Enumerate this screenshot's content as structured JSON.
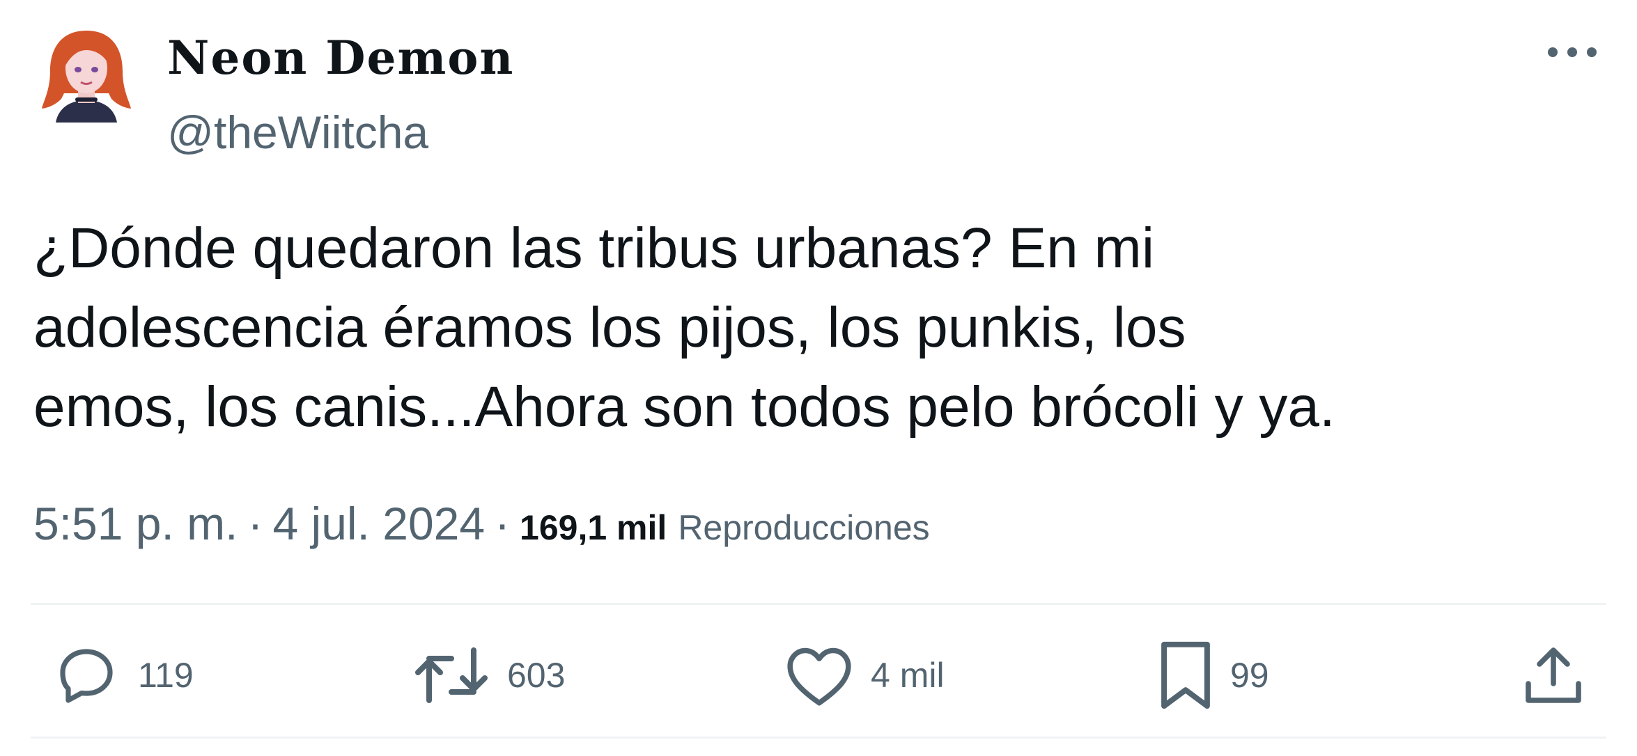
{
  "author": {
    "display_name": "Neon Demon",
    "handle": "@theWiitcha"
  },
  "tweet": {
    "text_lines": [
      "¿Dónde quedaron las tribus urbanas? En mi",
      "adolescencia éramos los pijos, los punkis, los",
      "emos, los canis...Ahora son todos pelo brócoli y ya."
    ]
  },
  "meta": {
    "time": "5:51 p. m.",
    "separator": "·",
    "date": "4 jul. 2024",
    "views_count": "169,1 mil",
    "views_label": "Reproducciones"
  },
  "actions": {
    "replies": "119",
    "retweets": "603",
    "likes": "4 mil",
    "bookmarks": "99"
  },
  "icons": {
    "more": "more-horizontal-icon",
    "reply": "reply-icon",
    "retweet": "retweet-icon",
    "like": "heart-icon",
    "bookmark": "bookmark-icon",
    "share": "share-icon"
  },
  "colors": {
    "text": "#0f1419",
    "secondary": "#536471",
    "divider": "#eff3f4"
  }
}
